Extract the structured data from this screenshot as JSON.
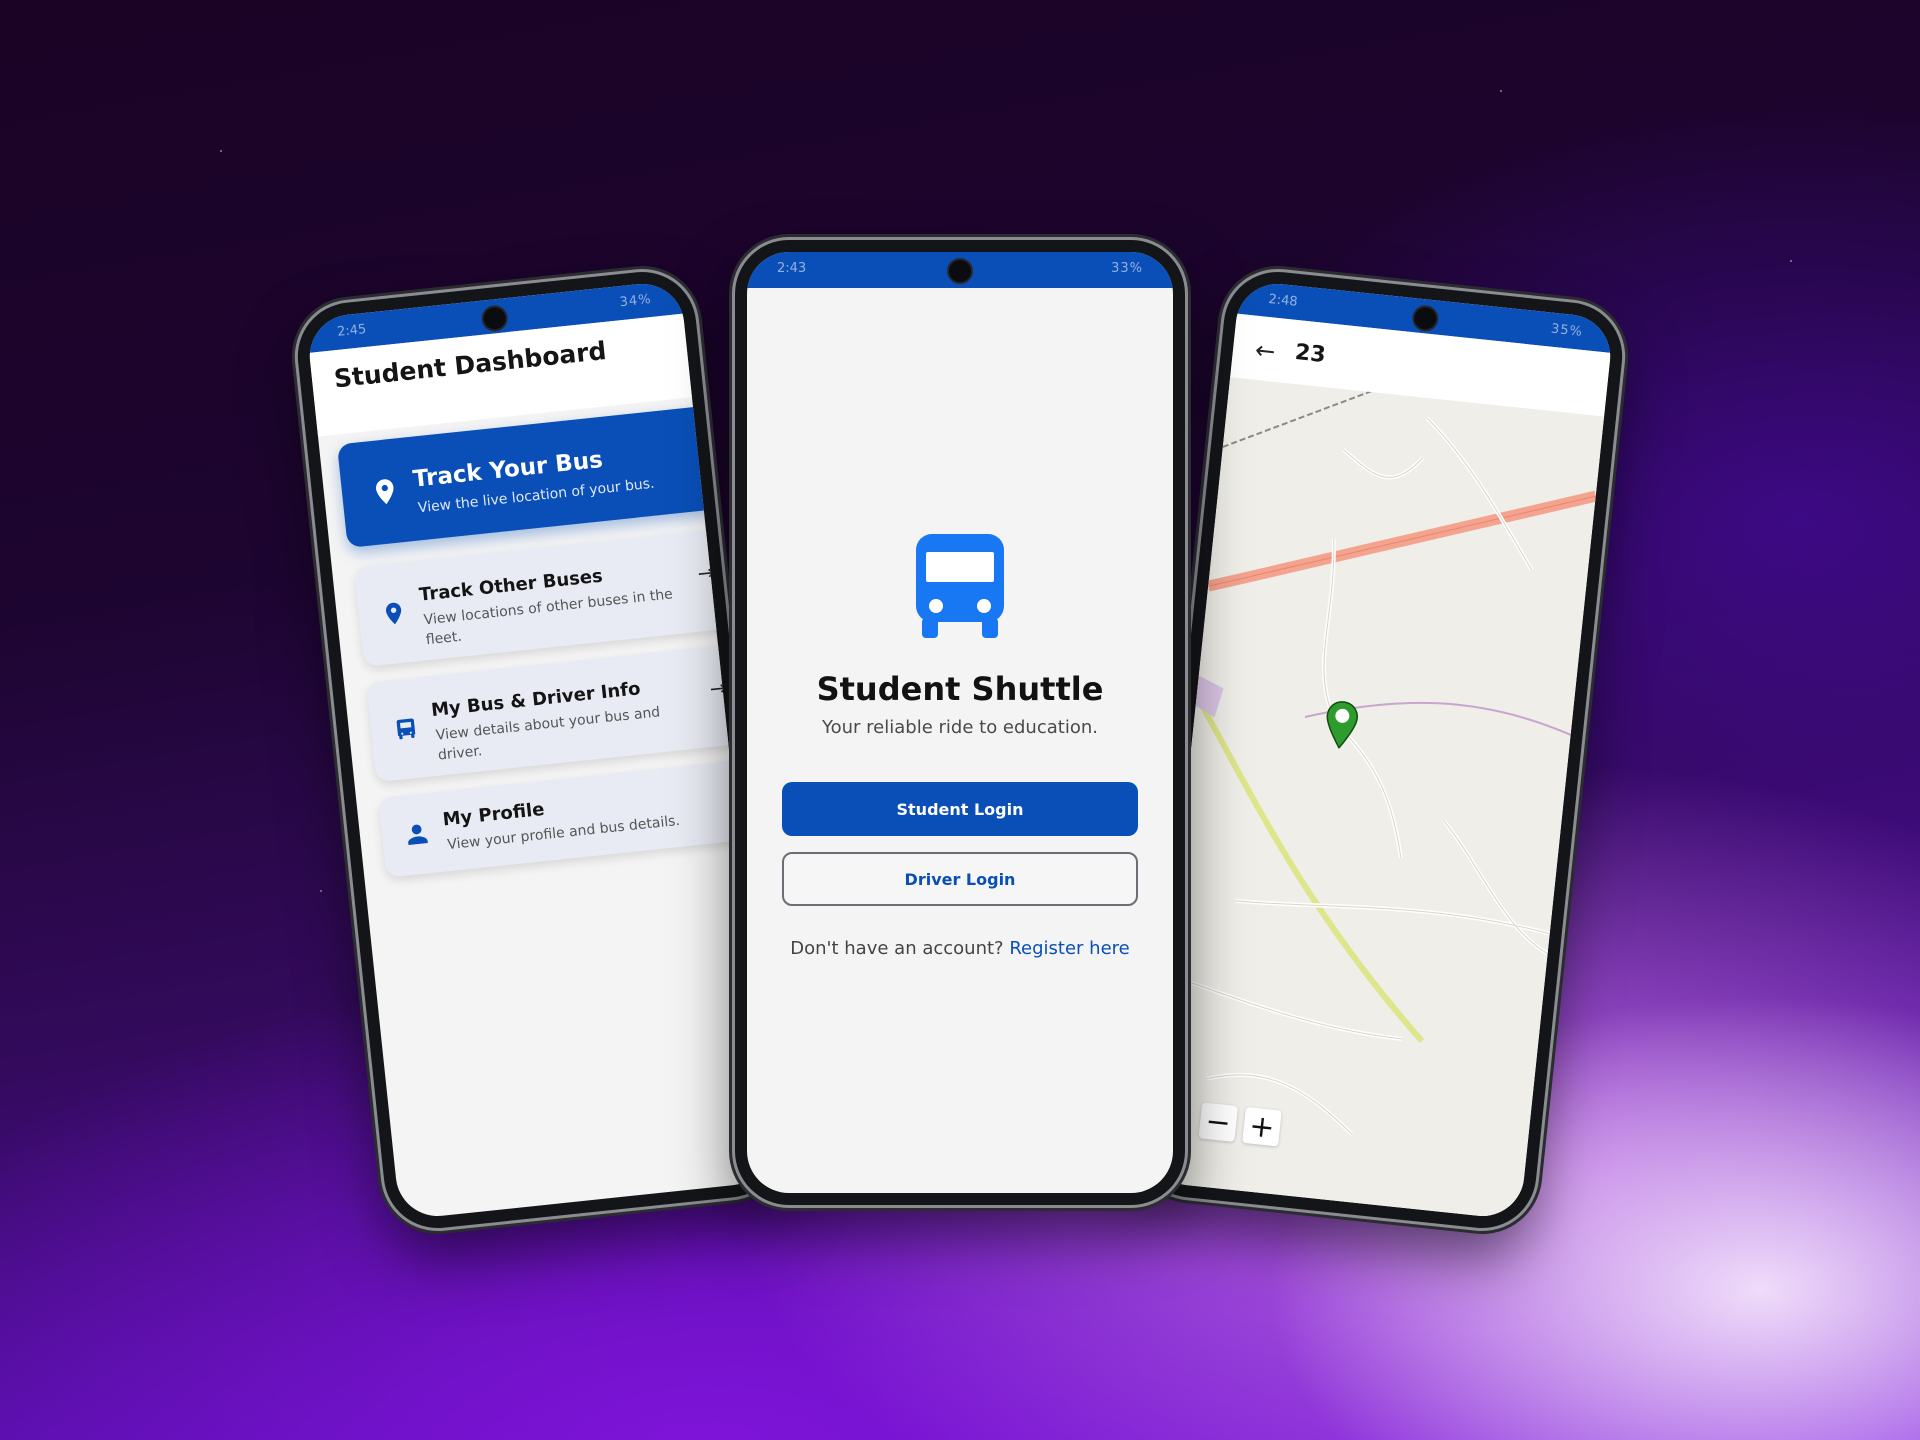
{
  "colors": {
    "brand": "#0a4fb8",
    "background_deep": "#1a0324",
    "background_glow": "#8a1ee0",
    "route_road": "#f3a38e",
    "marker_green": "#2e9b2e"
  },
  "left_phone": {
    "status_time": "2:45",
    "status_battery": "34%",
    "title": "Student Dashboard",
    "cards": [
      {
        "title": "Track Your Bus",
        "subtitle": "View the live location of your bus.",
        "icon": "location-pin-icon",
        "highlighted": true
      },
      {
        "title": "Track Other Buses",
        "subtitle": "View locations of other buses in the fleet.",
        "icon": "location-pin-icon",
        "arrow": "→"
      },
      {
        "title": "My Bus & Driver Info",
        "subtitle": "View details about your bus and driver.",
        "icon": "bus-icon",
        "arrow": "→"
      },
      {
        "title": "My Profile",
        "subtitle": "View your profile and bus details.",
        "icon": "person-icon"
      }
    ]
  },
  "center_phone": {
    "status_time": "2:43",
    "status_battery": "33%",
    "logo_icon": "bus-icon",
    "app_title": "Student Shuttle",
    "app_subtitle": "Your reliable ride to education.",
    "student_login_label": "Student Login",
    "driver_login_label": "Driver Login",
    "register_prompt": "Don't have an account?",
    "register_link": "Register here"
  },
  "right_phone": {
    "status_time": "2:48",
    "status_battery": "35%",
    "back_icon": "arrow-left-icon",
    "title": "23",
    "zoom_out_label": "−",
    "zoom_in_label": "+"
  }
}
